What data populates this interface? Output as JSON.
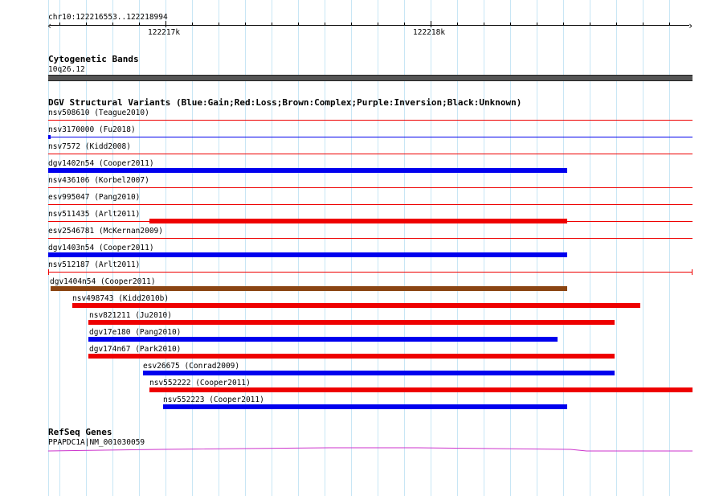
{
  "ruler": {
    "region": "chr10:122216553..122218994",
    "ticks": [
      {
        "label": "122217k"
      },
      {
        "label": "122218k"
      }
    ]
  },
  "cytoband": {
    "title": "Cytogenetic Bands",
    "band": "10q26.12"
  },
  "dgv": {
    "title": "DGV Structural Variants (Blue:Gain;Red:Loss;Brown:Complex;Purple:Inversion;Black:Unknown)",
    "colors": {
      "gain": "#0000ee",
      "loss": "#ee0000",
      "complex": "#8b4513"
    },
    "variants": [
      {
        "name": "nsv508610 (Teague2010)",
        "type": "loss",
        "start": 0.0,
        "end": 1.0,
        "style": "thin"
      },
      {
        "name": "nsv3170000 (Fu2018)",
        "type": "gain",
        "start": 0.0,
        "end": 1.0,
        "style": "thin-start"
      },
      {
        "name": "nsv7572 (Kidd2008)",
        "type": "loss",
        "start": 0.0,
        "end": 1.0,
        "style": "thin"
      },
      {
        "name": "dgv1402n54 (Cooper2011)",
        "type": "gain",
        "start": 0.0,
        "end": 0.806,
        "style": "thick"
      },
      {
        "name": "nsv436106 (Korbel2007)",
        "type": "loss",
        "start": 0.0,
        "end": 1.0,
        "style": "thin"
      },
      {
        "name": "esv995047 (Pang2010)",
        "type": "loss",
        "start": 0.0,
        "end": 1.0,
        "style": "thin"
      },
      {
        "name": "nsv511435 (Arlt2011)",
        "type": "loss",
        "start": 0.0,
        "end": 1.0,
        "style": "thin",
        "thick_start": 0.157,
        "thick_end": 0.806
      },
      {
        "name": "esv2546781 (McKernan2009)",
        "type": "loss",
        "start": 0.0,
        "end": 1.0,
        "style": "thin"
      },
      {
        "name": "dgv1403n54 (Cooper2011)",
        "type": "gain",
        "start": 0.0,
        "end": 0.806,
        "style": "thick"
      },
      {
        "name": "nsv512187 (Arlt2011)",
        "type": "loss",
        "start": 0.0,
        "end": 1.0,
        "style": "thin-caps"
      },
      {
        "name": "dgv1404n54 (Cooper2011)",
        "type": "complex",
        "start": 0.004,
        "end": 0.806,
        "style": "thick"
      },
      {
        "name": "nsv498743 (Kidd2010b)",
        "type": "loss",
        "start": 0.037,
        "end": 0.919,
        "style": "thick"
      },
      {
        "name": "nsv821211 (Ju2010)",
        "type": "loss",
        "start": 0.062,
        "end": 0.879,
        "style": "thick"
      },
      {
        "name": "dgv17e180 (Pang2010)",
        "type": "gain",
        "start": 0.062,
        "end": 0.79,
        "style": "thick"
      },
      {
        "name": "dgv174n67 (Park2010)",
        "type": "loss",
        "start": 0.062,
        "end": 0.879,
        "style": "thick"
      },
      {
        "name": "esv26675 (Conrad2009)",
        "type": "gain",
        "start": 0.147,
        "end": 0.879,
        "style": "thick"
      },
      {
        "name": "nsv552222 (Cooper2011)",
        "type": "loss",
        "start": 0.157,
        "end": 1.0,
        "style": "thick"
      },
      {
        "name": "nsv552223 (Cooper2011)",
        "type": "gain",
        "start": 0.178,
        "end": 0.806,
        "style": "thick"
      }
    ]
  },
  "refseq": {
    "title": "RefSeq Genes",
    "gene": "PPAPDC1A|NM_001030059",
    "color": "#cc33cc"
  }
}
